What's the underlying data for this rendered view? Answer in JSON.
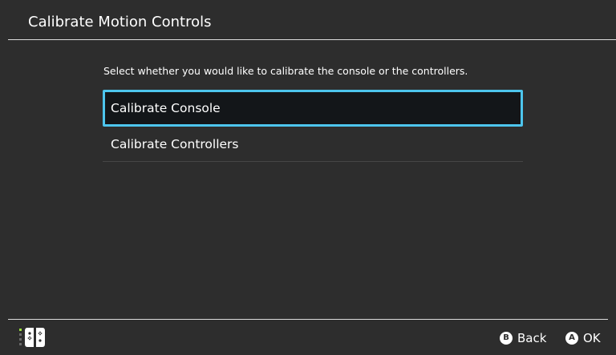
{
  "header": {
    "title": "Calibrate Motion Controls"
  },
  "main": {
    "instructions": "Select whether you would like to calibrate the console or the controllers.",
    "options": [
      {
        "label": "Calibrate Console",
        "selected": true
      },
      {
        "label": "Calibrate Controllers",
        "selected": false
      }
    ]
  },
  "footer": {
    "controller_icon": "joycon-pair-icon",
    "buttons": [
      {
        "glyph": "B",
        "label": "Back"
      },
      {
        "glyph": "A",
        "label": "OK"
      }
    ]
  },
  "colors": {
    "background": "#2d2d2d",
    "selection_border": "#4dc5ed",
    "selection_fill": "#131619",
    "player_indicator": "#9be03d"
  }
}
